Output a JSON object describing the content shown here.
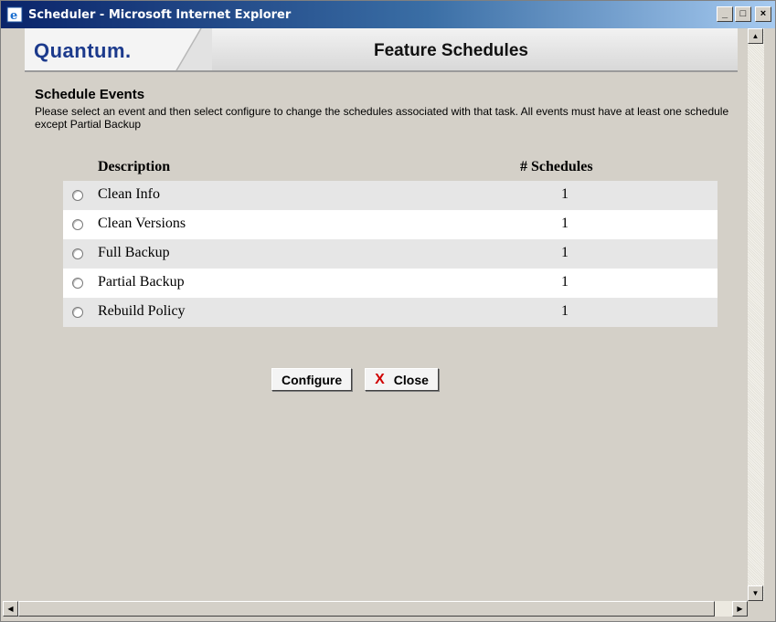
{
  "window": {
    "title": "Scheduler - Microsoft Internet Explorer",
    "minimize": "_",
    "maximize": "□",
    "close": "×"
  },
  "header": {
    "logo": "Quantum.",
    "title": "Feature Schedules"
  },
  "section": {
    "title": "Schedule Events",
    "instructions": "Please select an event and then select configure to change the schedules associated with that task. All events must have at least one schedule except Partial Backup"
  },
  "table": {
    "columns": [
      "Description",
      "# Schedules"
    ],
    "rows": [
      {
        "description": "Clean Info",
        "schedules": "1"
      },
      {
        "description": "Clean Versions",
        "schedules": "1"
      },
      {
        "description": "Full Backup",
        "schedules": "1"
      },
      {
        "description": "Partial Backup",
        "schedules": "1"
      },
      {
        "description": "Rebuild Policy",
        "schedules": "1"
      }
    ]
  },
  "buttons": {
    "configure": "Configure",
    "close_icon": "X",
    "close": "Close"
  },
  "icons": {
    "app": "ie-icon",
    "close": "x-icon"
  },
  "colors": {
    "logo": "#1c3a8c",
    "close_x": "#d00000",
    "titlebar_start": "#0a246a"
  }
}
